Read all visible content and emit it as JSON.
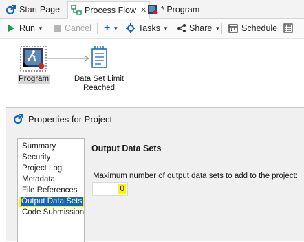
{
  "tabs": [
    {
      "label": "Start Page",
      "icon": "sas-home-icon"
    },
    {
      "label": "Process Flow",
      "icon": "process-flow-icon",
      "active": true,
      "close": "✕"
    },
    {
      "label": "* Program",
      "icon": "program-icon"
    }
  ],
  "toolbar": {
    "run": "Run",
    "cancel": "Cancel",
    "add": "+",
    "tasks": "Tasks",
    "share": "Share",
    "schedule": "Schedule"
  },
  "flow": {
    "program_label": "Program",
    "dataset_label_line1": "Data Set Limit",
    "dataset_label_line2": "Reached"
  },
  "dialog": {
    "title": "Properties for Project",
    "nav": [
      "Summary",
      "Security",
      "Project Log",
      "Metadata",
      "File References",
      "Output Data Sets",
      "Code Submission"
    ],
    "selected_index": 5,
    "section_title": "Output Data Sets",
    "field_label": "Maximum number of output data sets to add to the project:",
    "field_value": "0"
  },
  "colors": {
    "accent": "#1565b8",
    "highlight": "#fff700",
    "run_green": "#1a9a4b"
  }
}
